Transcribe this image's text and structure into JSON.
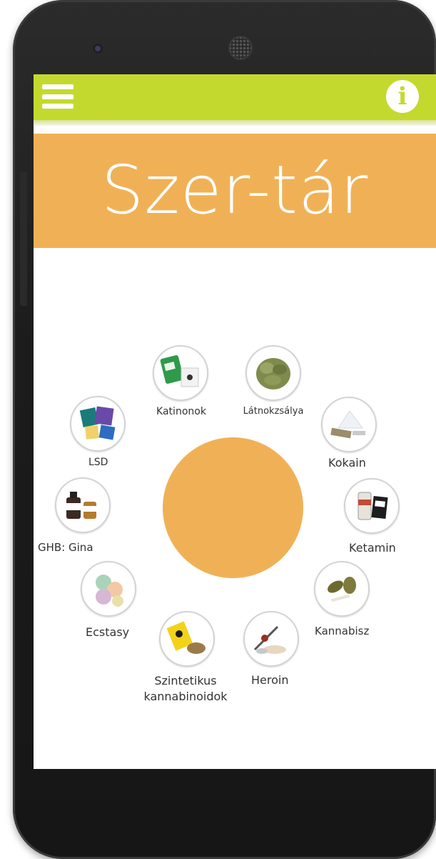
{
  "app": {
    "title": "Szer-tár"
  },
  "topbar": {
    "menu_icon": "hamburger-menu-icon",
    "info_icon": "info-icon",
    "info_glyph": "i"
  },
  "colors": {
    "topbar": "#c4d92e",
    "title_band": "#f0b156",
    "center_circle": "#f0b156"
  },
  "substances": [
    {
      "label": "Katinonok",
      "icon": "katinonok-packet-icon"
    },
    {
      "label": "Látnokzsálya",
      "icon": "latnokzsalya-leaves-icon"
    },
    {
      "label": "Kokain",
      "icon": "kokain-powder-icon"
    },
    {
      "label": "Ketamin",
      "icon": "ketamin-vial-icon"
    },
    {
      "label": "Kannabisz",
      "icon": "kannabisz-bud-icon"
    },
    {
      "label": "Heroin",
      "icon": "heroin-spoon-icon"
    },
    {
      "label": "Szintetikus\nkannabinoidok",
      "label_line1": "Szintetikus",
      "label_line2": "kannabinoidok",
      "icon": "szintetikus-packet-icon"
    },
    {
      "label": "Ecstasy",
      "icon": "ecstasy-pills-icon"
    },
    {
      "label": "GHB: Gina",
      "icon": "ghb-bottles-icon"
    },
    {
      "label": "LSD",
      "icon": "lsd-blotters-icon"
    }
  ]
}
